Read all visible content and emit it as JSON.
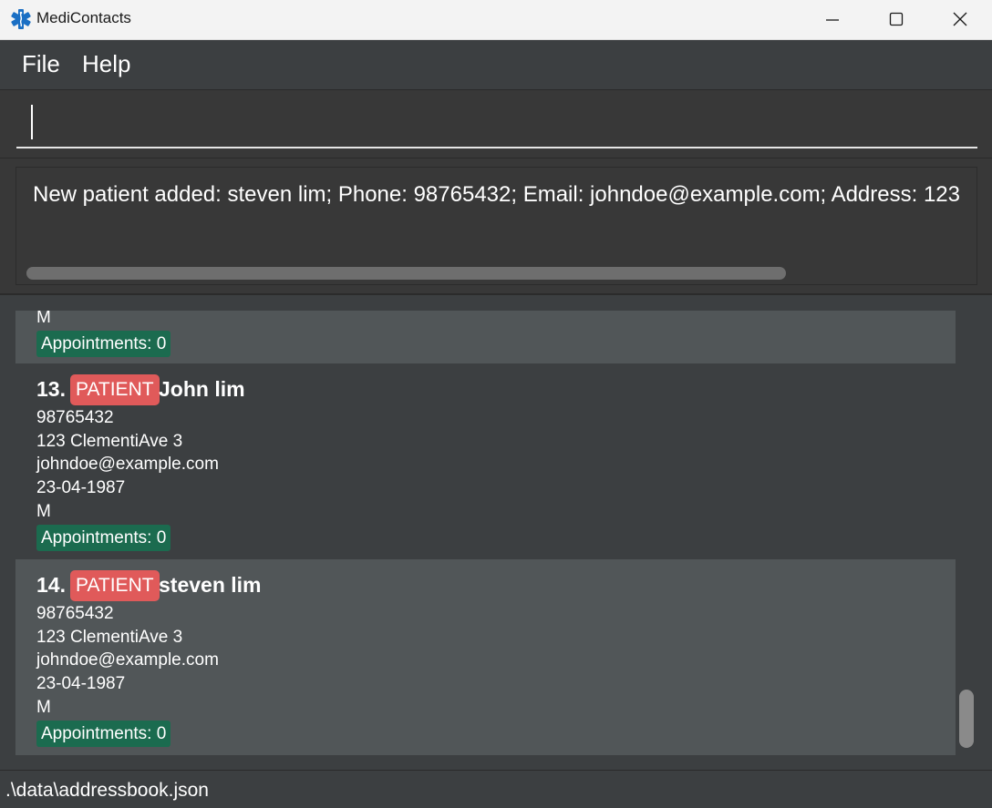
{
  "window": {
    "title": "MediContacts"
  },
  "menu": {
    "file": "File",
    "help": "Help"
  },
  "command": {
    "value": ""
  },
  "result": {
    "text": "New patient added: steven lim; Phone: 98765432; Email: johndoe@example.com; Address: 123"
  },
  "persons": [
    {
      "gender": "M",
      "appointments": "Appointments: 0"
    },
    {
      "index": "13.",
      "tag": "PATIENT",
      "name": "John lim",
      "phone": "98765432",
      "address": "123 ClementiAve 3",
      "email": "johndoe@example.com",
      "dob": "23-04-1987",
      "gender": "M",
      "appointments": "Appointments: 0"
    },
    {
      "index": "14.",
      "tag": "PATIENT",
      "name": "steven lim",
      "phone": "98765432",
      "address": "123 ClementiAve 3",
      "email": "johndoe@example.com",
      "dob": "23-04-1987",
      "gender": "M",
      "appointments": "Appointments: 0"
    }
  ],
  "status": {
    "file_path": ".\\data\\addressbook.json"
  },
  "icons": {
    "app": "medical-star-icon",
    "minimize": "minimize-icon",
    "maximize": "maximize-icon",
    "close": "close-icon"
  },
  "colors": {
    "patient_tag": "#e05a5a",
    "appointment_badge": "#1b6b4f",
    "background": "#3c3f41",
    "card_alt": "#515658"
  }
}
